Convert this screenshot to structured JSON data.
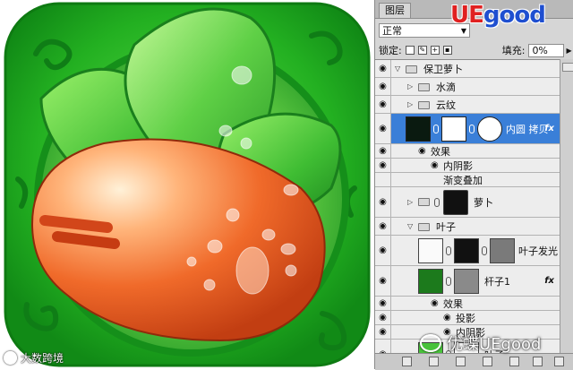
{
  "watermark_left": "大数跨境",
  "brand": {
    "u": "UE",
    "rest": "good"
  },
  "panel": {
    "tab": "图层",
    "blend_mode": "正常",
    "lock_label": "锁定:",
    "fill_label": "填充:",
    "fill_value": "0%"
  },
  "layers": [
    {
      "label": "保卫萝卜"
    },
    {
      "label": "水滴"
    },
    {
      "label": "云纹"
    },
    {
      "label": "内圆 拷贝",
      "fx": "fx"
    },
    {
      "label": "效果"
    },
    {
      "label": "内阴影"
    },
    {
      "label": "渐变叠加"
    },
    {
      "label": "萝卜"
    },
    {
      "label": "叶子"
    },
    {
      "label": "叶子发光"
    },
    {
      "label": "杆子1",
      "fx": "fx"
    },
    {
      "label": "效果"
    },
    {
      "label": "投影"
    },
    {
      "label": "内阴影"
    },
    {
      "label": "叶子"
    }
  ],
  "watermark_right": "优蝶UEgood",
  "colors": {
    "accent": "#3a7fd8",
    "icon_green": "#2db52a",
    "carrot": "#f06a2a"
  }
}
